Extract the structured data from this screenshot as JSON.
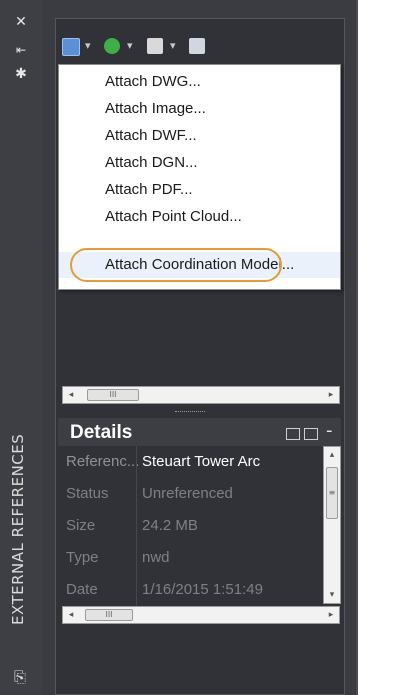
{
  "palette": {
    "title": "EXTERNAL REFERENCES",
    "strip_buttons": [
      {
        "icon": "close-icon",
        "glyph": "✕"
      },
      {
        "icon": "autohide-icon",
        "glyph": "⇤"
      },
      {
        "icon": "properties-icon",
        "glyph": "✱"
      }
    ],
    "bottom_icon": "⎘"
  },
  "toolbar": {
    "buttons": [
      {
        "icon": "attach-icon",
        "color": "#5b8fd6"
      },
      {
        "icon": "refresh-icon",
        "color": "#3fae49"
      },
      {
        "icon": "change-path-icon",
        "color": "#d9d9d9"
      },
      {
        "icon": "help-icon",
        "color": "#d0d7e2"
      }
    ],
    "drop_glyph": "▾"
  },
  "menu": {
    "items": [
      "Attach DWG...",
      "Attach Image...",
      "Attach DWF...",
      "Attach DGN...",
      "Attach PDF...",
      "Attach Point Cloud...",
      "Attach Coordination Model..."
    ],
    "highlighted_index": 6,
    "highlight_color": "#e59a3c"
  },
  "scroll": {
    "left_arrow": "◂",
    "right_arrow": "▸",
    "up_arrow": "▴",
    "down_arrow": "▾",
    "thumb_grip": "III",
    "vthumb_grip": "≡"
  },
  "details": {
    "title": "Details",
    "minus": "-",
    "rows": [
      {
        "label": "Referenc...",
        "value": "Steuart Tower Arc"
      },
      {
        "label": "Status",
        "value": "Unreferenced"
      },
      {
        "label": "Size",
        "value": "24.2 MB"
      },
      {
        "label": "Type",
        "value": "nwd"
      },
      {
        "label": "Date",
        "value": "1/16/2015 1:51:49"
      }
    ]
  }
}
